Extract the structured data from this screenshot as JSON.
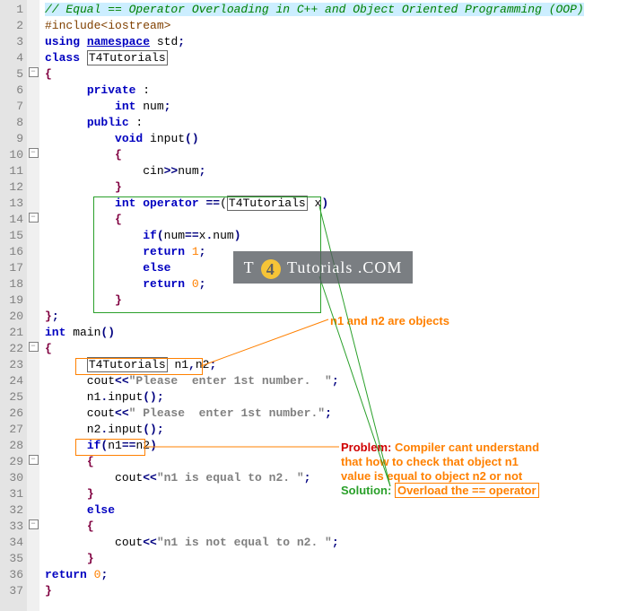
{
  "lines": [
    {
      "n": 1,
      "fold": "",
      "html": "<span class='hl-title'><span class='c-comment'>// Equal == Operator Overloading in C++ and Object Oriented Programming (OOP)</span></span>"
    },
    {
      "n": 2,
      "fold": "",
      "html": "<span class='c-pre'>#include&lt;iostream&gt;</span>"
    },
    {
      "n": 3,
      "fold": "",
      "html": "<span class='c-kw'>using</span> <span class='c-kw' style='text-decoration:underline'>namespace</span> <span class='c-ident'>std</span><span class='c-op'>;</span>"
    },
    {
      "n": 4,
      "fold": "",
      "html": "<span class='c-kw'>class</span> <span class='boxed'>T4Tutorials</span>"
    },
    {
      "n": 5,
      "fold": "−",
      "html": "<span class='c-brace'>{</span>"
    },
    {
      "n": 6,
      "fold": "",
      "html": "      <span class='c-kw'>private</span> :"
    },
    {
      "n": 7,
      "fold": "",
      "html": "          <span class='c-kw'>int</span> num<span class='c-op'>;</span>"
    },
    {
      "n": 8,
      "fold": "",
      "html": "      <span class='c-kw'>public</span> :"
    },
    {
      "n": 9,
      "fold": "",
      "html": "          <span class='c-kw'>void</span> input<span class='c-op'>()</span>"
    },
    {
      "n": 10,
      "fold": "−",
      "html": "          <span class='c-brace'>{</span>"
    },
    {
      "n": 11,
      "fold": "",
      "html": "              cin<span class='c-op'>&gt;&gt;</span>num<span class='c-op'>;</span>"
    },
    {
      "n": 12,
      "fold": "",
      "html": "          <span class='c-brace'>}</span>"
    },
    {
      "n": 13,
      "fold": "",
      "html": "          <span class='c-kw'>int</span> <span class='c-kw'>operator</span> <span class='c-op'>==</span>(<span class='boxed'>T4Tutorials</span> x<span class='c-op'>)</span>"
    },
    {
      "n": 14,
      "fold": "−",
      "html": "          <span class='c-brace'>{</span>"
    },
    {
      "n": 15,
      "fold": "",
      "html": "              <span class='c-kw'>if</span><span class='c-op'>(</span>num<span class='c-op'>==</span>x<span class='c-op'>.</span>num<span class='c-op'>)</span>"
    },
    {
      "n": 16,
      "fold": "",
      "html": "              <span class='c-kw'>return</span> <span class='c-num'>1</span><span class='c-op'>;</span>"
    },
    {
      "n": 17,
      "fold": "",
      "html": "              <span class='c-kw'>else</span>"
    },
    {
      "n": 18,
      "fold": "",
      "html": "              <span class='c-kw'>return</span> <span class='c-num'>0</span><span class='c-op'>;</span>"
    },
    {
      "n": 19,
      "fold": "",
      "html": "          <span class='c-brace'>}</span>"
    },
    {
      "n": 20,
      "fold": "",
      "html": "<span class='c-brace'>}</span><span class='c-op'>;</span>"
    },
    {
      "n": 21,
      "fold": "",
      "html": "<span class='c-kw'>int</span> main<span class='c-op'>()</span>"
    },
    {
      "n": 22,
      "fold": "−",
      "html": "<span class='c-brace'>{</span>"
    },
    {
      "n": 23,
      "fold": "",
      "html": "      <span class='boxed'>T4Tutorials</span> n1<span class='c-op'>,</span>n2<span class='c-op'>;</span>"
    },
    {
      "n": 24,
      "fold": "",
      "html": "      cout<span class='c-op'>&lt;&lt;</span><span class='c-str'>\"Please  enter 1st number.  \"</span><span class='c-op'>;</span>"
    },
    {
      "n": 25,
      "fold": "",
      "html": "      n1<span class='c-op'>.</span>input<span class='c-op'>();</span>"
    },
    {
      "n": 26,
      "fold": "",
      "html": "      cout<span class='c-op'>&lt;&lt;</span><span class='c-str'>\" Please  enter 1st number.\"</span><span class='c-op'>;</span>"
    },
    {
      "n": 27,
      "fold": "",
      "html": "      n2<span class='c-op'>.</span>input<span class='c-op'>();</span>"
    },
    {
      "n": 28,
      "fold": "",
      "html": "      <span class='c-kw'>if</span><span class='c-op'>(</span>n1<span class='c-op'>==</span>n2<span class='c-op'>)</span>"
    },
    {
      "n": 29,
      "fold": "−",
      "html": "      <span class='c-brace'>{</span>"
    },
    {
      "n": 30,
      "fold": "",
      "html": "          cout<span class='c-op'>&lt;&lt;</span><span class='c-str'>\"n1 is equal to n2. \"</span><span class='c-op'>;</span>"
    },
    {
      "n": 31,
      "fold": "",
      "html": "      <span class='c-brace'>}</span>"
    },
    {
      "n": 32,
      "fold": "",
      "html": "      <span class='c-kw'>else</span>"
    },
    {
      "n": 33,
      "fold": "−",
      "html": "      <span class='c-brace'>{</span>"
    },
    {
      "n": 34,
      "fold": "",
      "html": "          cout<span class='c-op'>&lt;&lt;</span><span class='c-str'>\"n1 is not equal to n2. \"</span><span class='c-op'>;</span>"
    },
    {
      "n": 35,
      "fold": "",
      "html": "      <span class='c-brace'>}</span>"
    },
    {
      "n": 36,
      "fold": "",
      "html": "<span class='c-kw'>return</span> <span class='c-num'>0</span><span class='c-op'>;</span>"
    },
    {
      "n": 37,
      "fold": "",
      "html": "<span class='c-brace'>}</span>"
    }
  ],
  "annot": {
    "objects_label": "n1 and n2 are objects",
    "problem_label": "Problem:",
    "problem_text1": "Compiler cant understand",
    "problem_text2": "that how to check that object n1",
    "problem_text3": "value is equal to object n2 or not",
    "solution_label": "Solution:",
    "solution_text": "Overload the == operator"
  },
  "watermark": {
    "left": "T",
    "mid": "4",
    "right": "Tutorials .COM"
  }
}
